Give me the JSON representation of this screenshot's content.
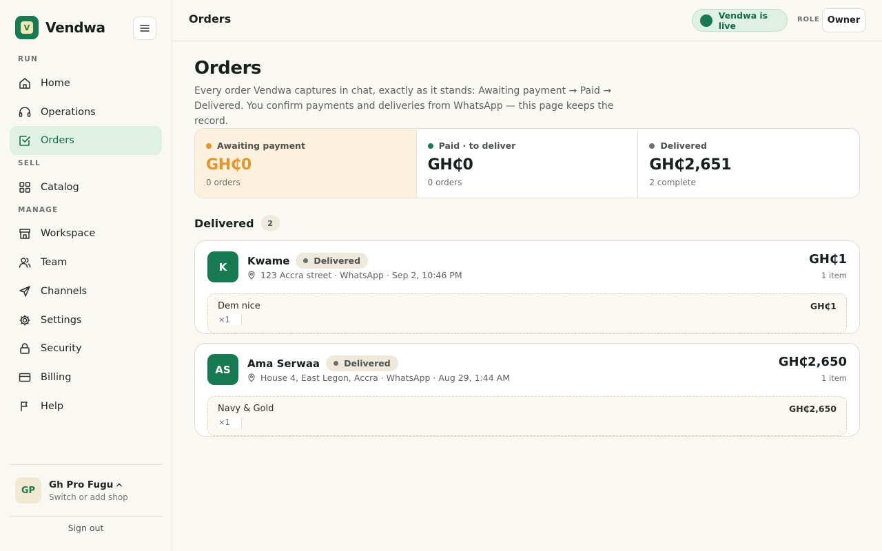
{
  "brand": {
    "name": "Vendwa",
    "logo_letter": "V"
  },
  "sidebar": {
    "sections": [
      {
        "label": "RUN"
      },
      {
        "label": "SELL"
      },
      {
        "label": "MANAGE"
      }
    ],
    "items": [
      {
        "label": "Home",
        "icon": "home-icon"
      },
      {
        "label": "Operations",
        "icon": "headset-icon"
      },
      {
        "label": "Orders",
        "icon": "checkbox-icon",
        "active": true
      },
      {
        "label": "Catalog",
        "icon": "grid-icon"
      },
      {
        "label": "Workspace",
        "icon": "store-icon"
      },
      {
        "label": "Team",
        "icon": "users-icon"
      },
      {
        "label": "Channels",
        "icon": "send-icon"
      },
      {
        "label": "Settings",
        "icon": "gear-icon"
      },
      {
        "label": "Security",
        "icon": "lock-icon"
      },
      {
        "label": "Billing",
        "icon": "card-icon"
      },
      {
        "label": "Help",
        "icon": "flag-icon"
      }
    ],
    "shop": {
      "initials": "GP",
      "name": "Gh Pro Fugu",
      "subtitle": "Switch or add shop"
    },
    "sign_out": "Sign out"
  },
  "header": {
    "title": "Orders",
    "live_status": "Vendwa is live",
    "role_label": "ROLE",
    "role_value": "Owner"
  },
  "main": {
    "title": "Orders",
    "description": "Every order Vendwa captures in chat, exactly as it stands: Awaiting payment → Paid → Delivered. You confirm payments and deliveries from WhatsApp — this page keeps the record.",
    "stats": [
      {
        "label": "Awaiting payment",
        "value": "GH₵0",
        "sub": "0 orders",
        "color": "#e4962c"
      },
      {
        "label": "Paid · to deliver",
        "value": "GH₵0",
        "sub": "0 orders",
        "color": "#177a52"
      },
      {
        "label": "Delivered",
        "value": "GH₵2,651",
        "sub": "2 complete",
        "color": "#6c6f6c"
      }
    ],
    "group": {
      "title": "Delivered",
      "count": "2"
    },
    "orders": [
      {
        "initials": "K",
        "name": "Kwame",
        "status": "Delivered",
        "meta": "123 Accra street · WhatsApp · Sep 2, 10:46 PM",
        "total": "GH₵1",
        "items_count": "1 item",
        "line": {
          "name": "Dem nice",
          "qty": "×1",
          "price": "GH₵1"
        }
      },
      {
        "initials": "AS",
        "name": "Ama Serwaa",
        "status": "Delivered",
        "meta": "House 4, East Legon, Accra · WhatsApp · Aug 29, 1:44 AM",
        "total": "GH₵2,650",
        "items_count": "1 item",
        "line": {
          "name": "Navy & Gold",
          "qty": "×1",
          "price": "GH₵2,650"
        }
      }
    ]
  },
  "colors": {
    "accent": "#177a52",
    "active_bg": "#dff0e5",
    "warning": "#e4962c"
  }
}
